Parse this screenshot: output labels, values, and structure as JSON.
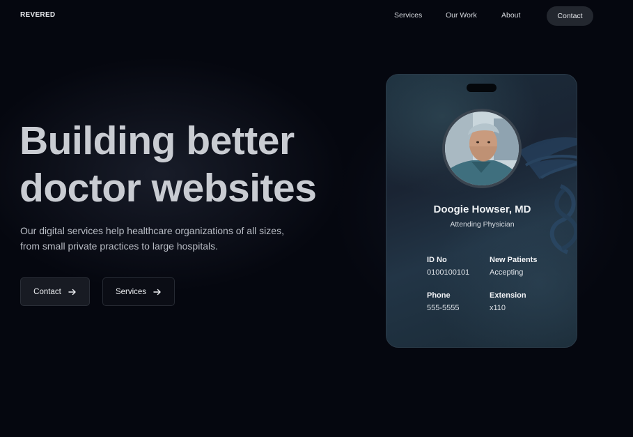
{
  "nav": {
    "brand": "REVERED",
    "links": [
      "Services",
      "Our Work",
      "About"
    ],
    "contact_label": "Contact"
  },
  "hero": {
    "headline_line1": "Building better",
    "headline_line2": "doctor websites",
    "subtext": "Our digital services help healthcare organizations of all sizes, from small private practices to large hospitals.",
    "cta_contact": "Contact",
    "cta_services": "Services"
  },
  "badge": {
    "name": "Doogie Howser, MD",
    "title": "Attending Physician",
    "fields": [
      {
        "label": "ID No",
        "value": "0100100101"
      },
      {
        "label": "New Patients",
        "value": "Accepting"
      },
      {
        "label": "Phone",
        "value": "555-5555"
      },
      {
        "label": "Extension",
        "value": "x110"
      }
    ]
  },
  "icons": {
    "cta_arrow": "arrow-right-icon",
    "badge_emblem": "caduceus-icon"
  },
  "colors": {
    "background": "#05070f",
    "headline": "#c9ccd2",
    "nav_contact_bg": "#23272f",
    "badge_bg": "#1c2e3c"
  }
}
